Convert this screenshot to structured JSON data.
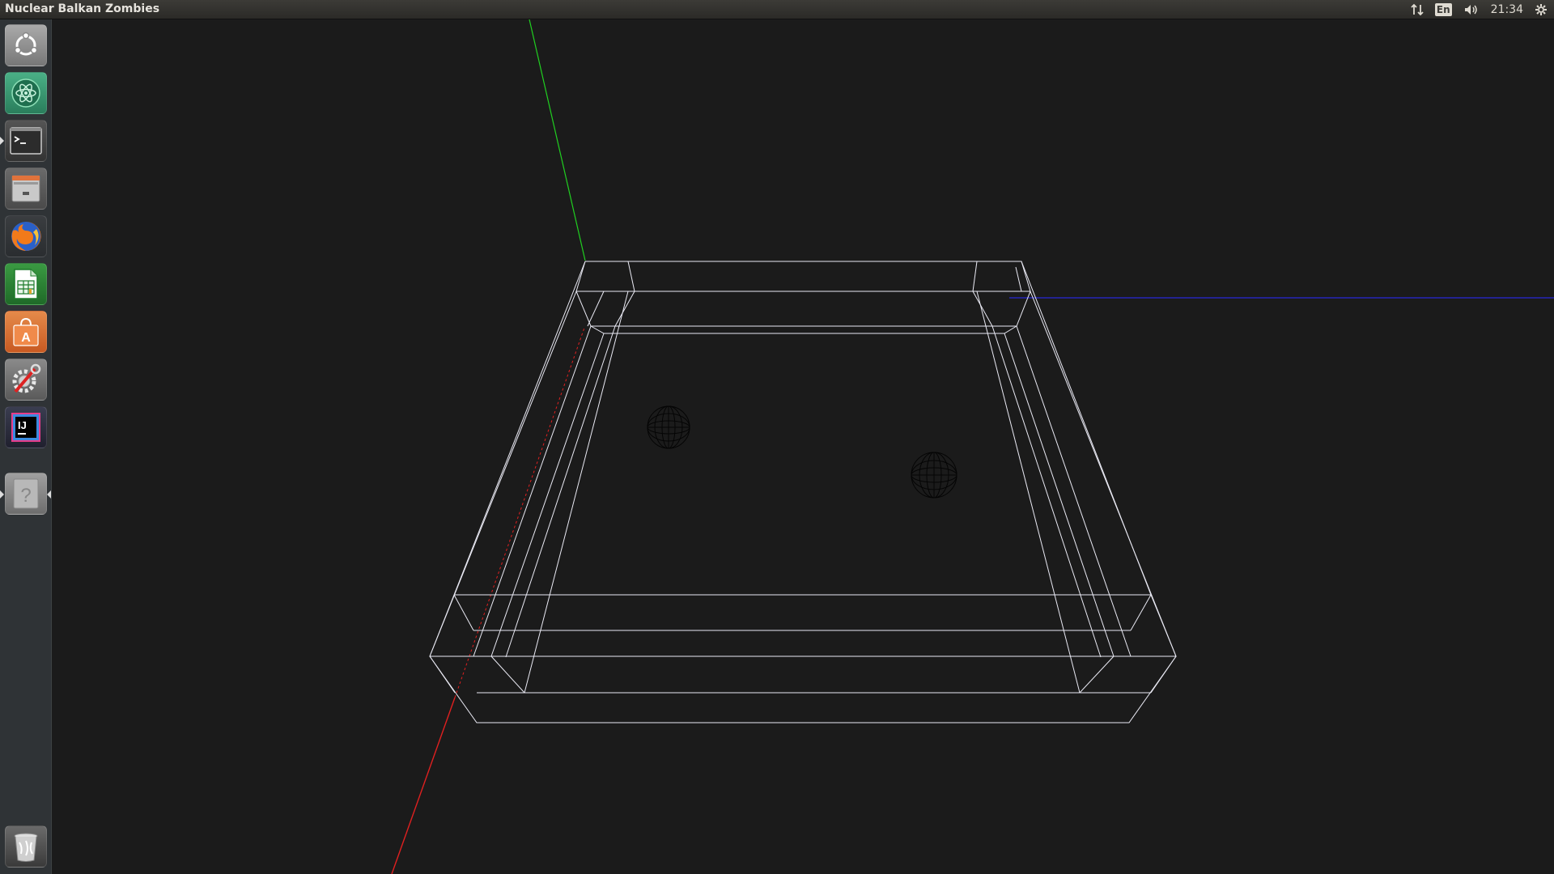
{
  "topbar": {
    "app_title": "Nuclear Balkan Zombies",
    "keyboard_layout": "En",
    "clock": "21:34"
  },
  "launcher": {
    "items": [
      {
        "name": "ubuntu-dash",
        "icon": "ubuntu-logo-icon",
        "color": "#9a9a9a"
      },
      {
        "name": "atom-editor",
        "icon": "atom-icon",
        "color": "#3a9a72"
      },
      {
        "name": "terminal",
        "icon": "terminal-icon",
        "color": "#4a4a4a"
      },
      {
        "name": "files",
        "icon": "file-cabinet-icon",
        "color": "#8a8a8a"
      },
      {
        "name": "firefox",
        "icon": "firefox-icon",
        "color": "#e8582a"
      },
      {
        "name": "libreoffice-calc",
        "icon": "spreadsheet-icon",
        "color": "#2e9a3a"
      },
      {
        "name": "ubuntu-software",
        "icon": "software-bag-icon",
        "color": "#e2733a"
      },
      {
        "name": "system-settings",
        "icon": "gear-wrench-icon",
        "color": "#7a7a7a"
      },
      {
        "name": "intellij-idea",
        "icon": "intellij-icon",
        "color": "#2a2a6a"
      },
      {
        "name": "unknown-app",
        "icon": "question-icon",
        "color": "#8c8c8c"
      },
      {
        "name": "trash",
        "icon": "trash-icon",
        "color": "#5a5a5a"
      }
    ]
  },
  "scene": {
    "background": "#1b1b1b",
    "axis_x_color": "#e02020",
    "axis_y_color": "#20d020",
    "axis_z_color": "#2020d0",
    "wireframe_color": "#e8e8f4",
    "sphere_color": "#050505",
    "spheres": 2
  }
}
